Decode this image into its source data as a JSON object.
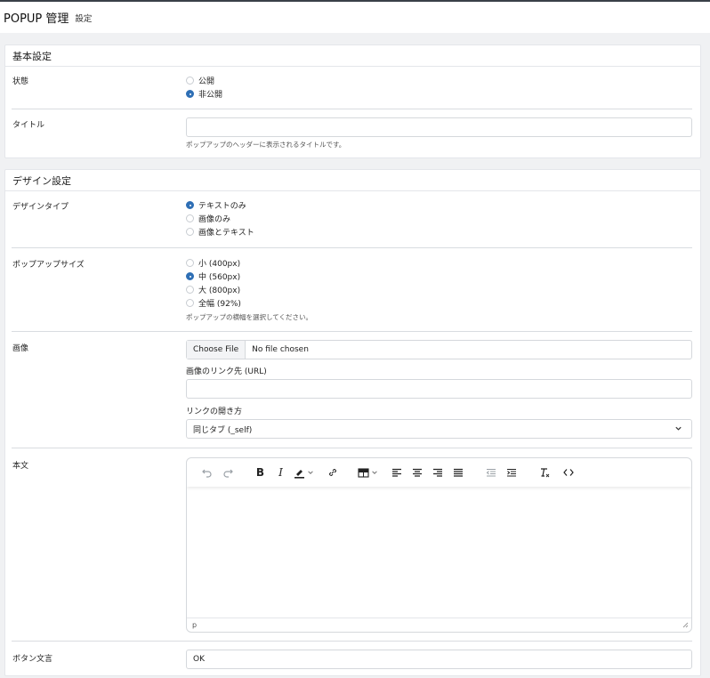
{
  "header": {
    "title": "POPUP 管理",
    "subtitle": "設定"
  },
  "basic": {
    "heading": "基本設定",
    "status": {
      "label": "状態",
      "options": [
        "公開",
        "非公開"
      ],
      "selected": 1
    },
    "title_field": {
      "label": "タイトル",
      "value": "",
      "help": "ポップアップのヘッダーに表示されるタイトルです。"
    }
  },
  "design": {
    "heading": "デザイン設定",
    "type": {
      "label": "デザインタイプ",
      "options": [
        "テキストのみ",
        "画像のみ",
        "画像とテキスト"
      ],
      "selected": 0
    },
    "size": {
      "label": "ポップアップサイズ",
      "options": [
        "小 (400px)",
        "中 (560px)",
        "大 (800px)",
        "全幅 (92%)"
      ],
      "selected": 1,
      "help": "ポップアップの横幅を選択してください。"
    },
    "image": {
      "label": "画像",
      "file_button": "Choose File",
      "file_status": "No file chosen",
      "link_label": "画像のリンク先 (URL)",
      "link_value": "",
      "open_label": "リンクの開き方",
      "open_value": "同じタブ (_self)"
    },
    "body": {
      "label": "本文",
      "status_path": "p"
    },
    "button_text": {
      "label": "ボタン文言",
      "value": "OK"
    }
  },
  "colors": {
    "accent": "#2f6fb5",
    "page_bg": "#f0f1f3",
    "border": "#d5d8dc"
  }
}
